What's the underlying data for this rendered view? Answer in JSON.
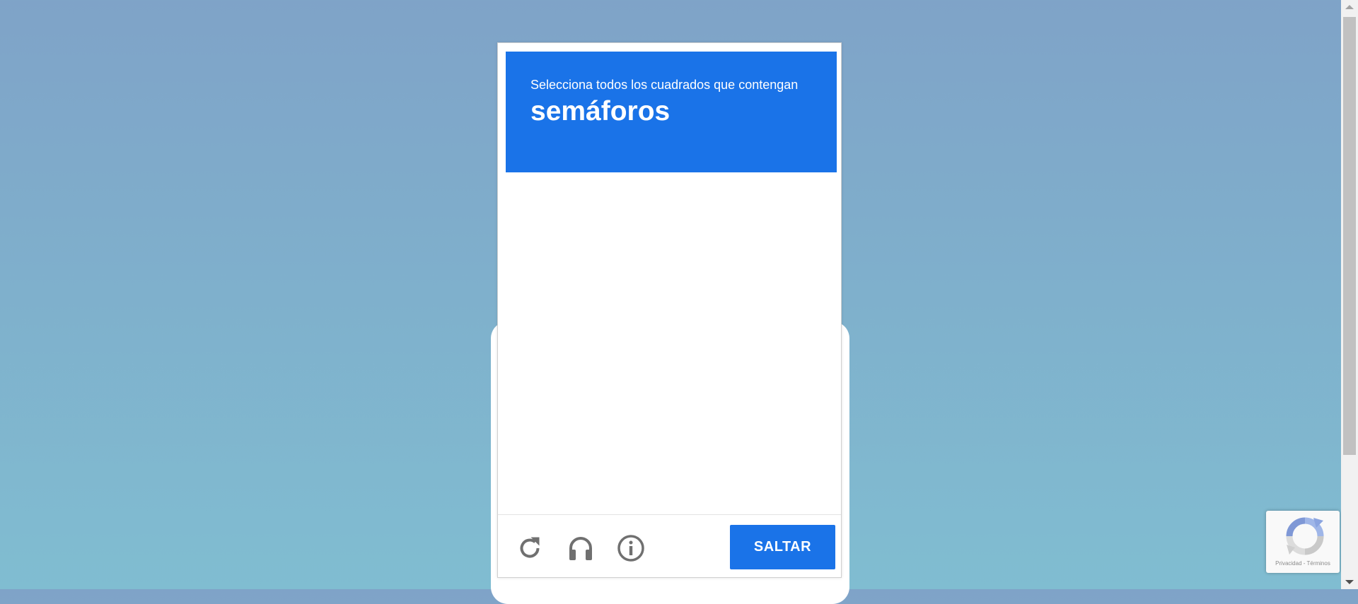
{
  "captcha": {
    "instruction": "Selecciona todos los cuadrados que contengan",
    "keyword": "semáforos",
    "skip_label": "SALTAR",
    "icons": {
      "reload": "reload-icon",
      "audio": "headphones-icon",
      "info": "info-icon"
    }
  },
  "recaptcha": {
    "links_text": "Privacidad - Términos"
  },
  "colors": {
    "accent": "#1a73e8",
    "icon": "#707070",
    "background_top": "#7fa3c8",
    "background_bottom": "#80bdd1"
  }
}
